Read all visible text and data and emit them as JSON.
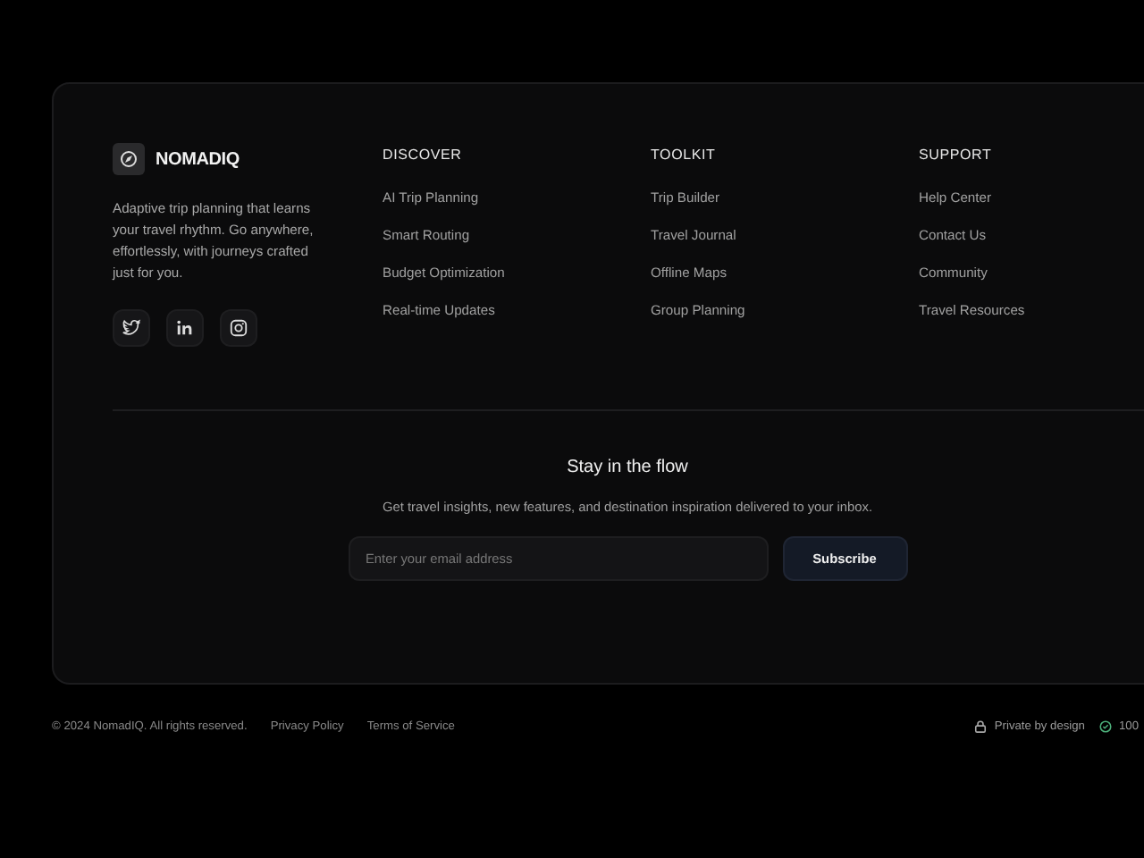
{
  "brand": {
    "name": "NOMADIQ",
    "tagline": "Adaptive trip planning that learns your travel rhythm. Go anywhere, effortlessly, with journeys crafted just for you."
  },
  "social": [
    {
      "kind": "bird"
    },
    {
      "kind": "linkedin"
    },
    {
      "kind": "camera"
    }
  ],
  "columns": [
    {
      "heading": "DISCOVER",
      "links": [
        "AI Trip Planning",
        "Smart Routing",
        "Budget Optimization",
        "Real-time Updates"
      ]
    },
    {
      "heading": "TOOLKIT",
      "links": [
        "Trip Builder",
        "Travel Journal",
        "Offline Maps",
        "Group Planning"
      ]
    },
    {
      "heading": "SUPPORT",
      "links": [
        "Help Center",
        "Contact Us",
        "Community",
        "Travel Resources"
      ]
    }
  ],
  "newsletter": {
    "title": "Stay in the flow",
    "text": "Get travel insights, new features, and destination inspiration delivered to your inbox.",
    "placeholder": "Enter your email address",
    "button": "Subscribe"
  },
  "bottom": {
    "copyright": "© 2024 NomadIQ. All rights reserved.",
    "links": [
      "Privacy Policy",
      "Terms of Service"
    ],
    "badges": [
      {
        "kind": "lock",
        "label": "Private by design"
      },
      {
        "kind": "check",
        "label": "100"
      }
    ]
  }
}
